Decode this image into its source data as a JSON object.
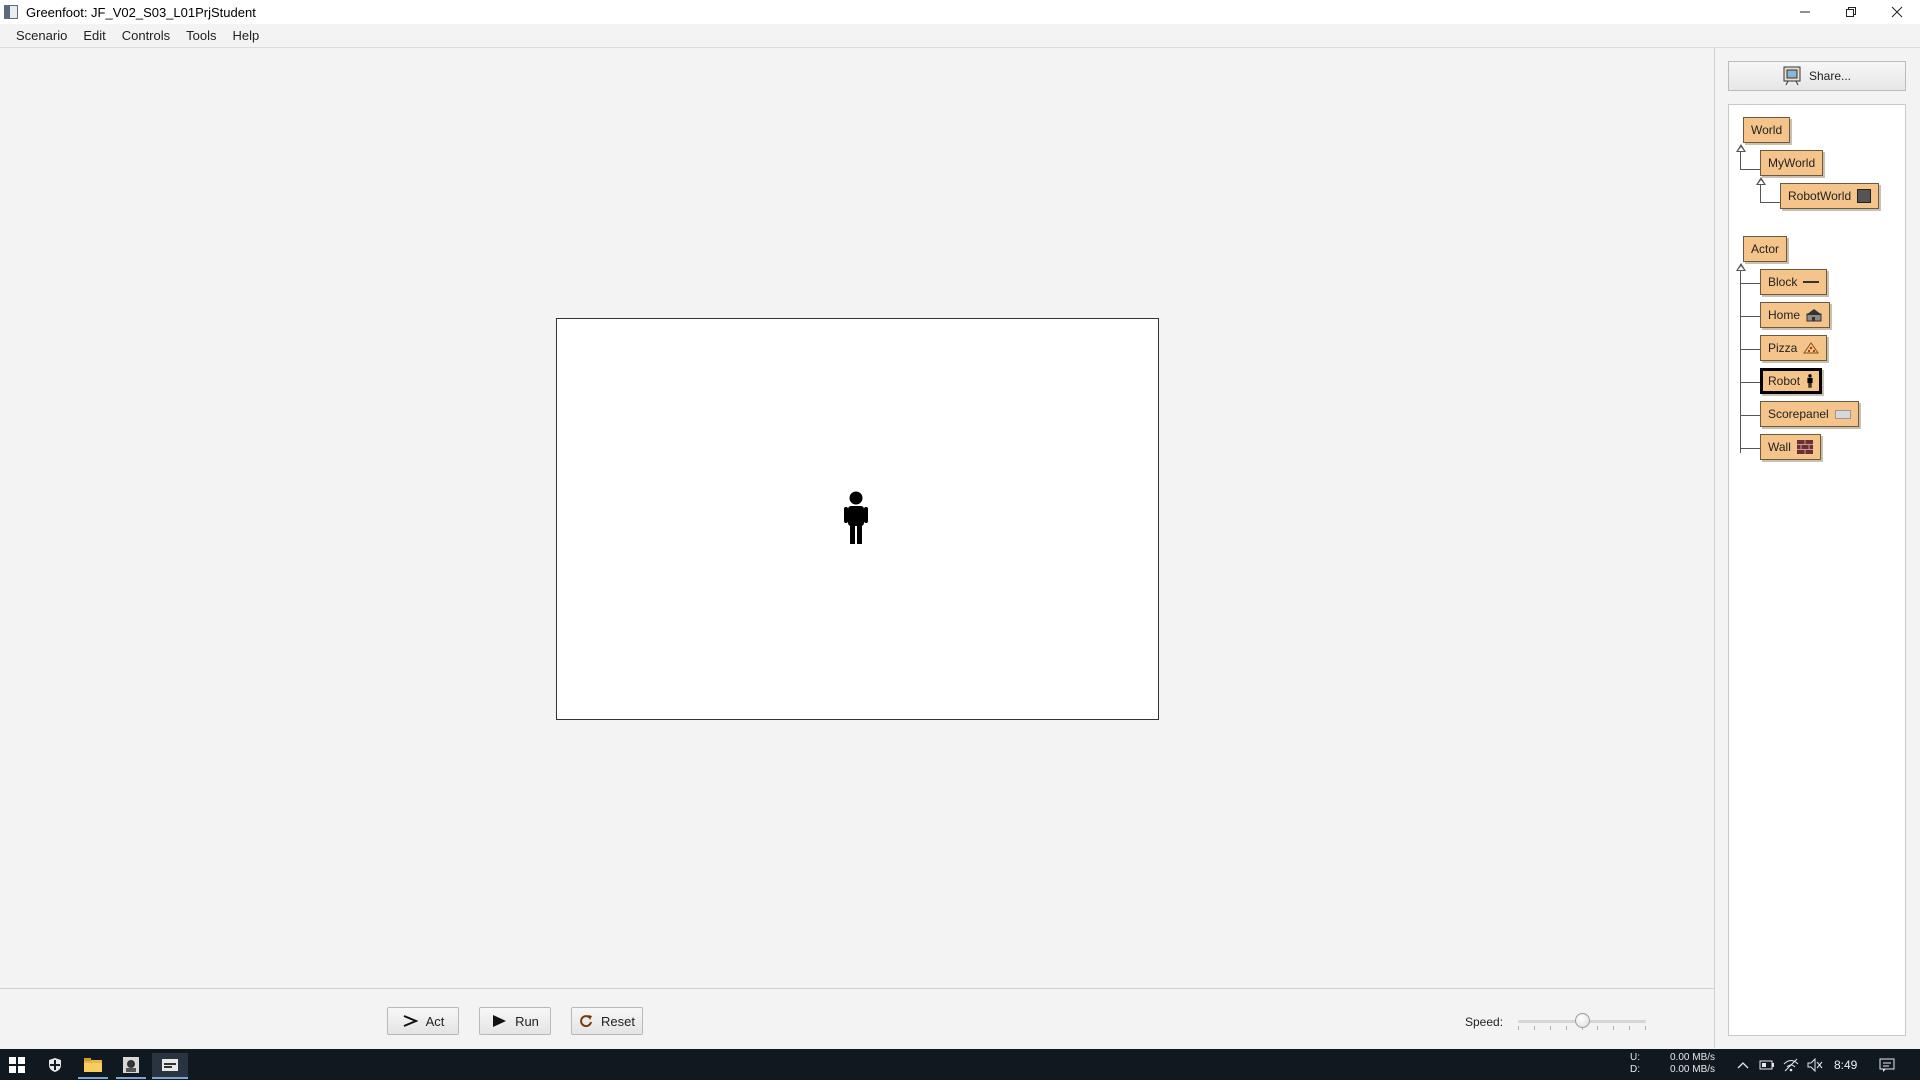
{
  "window": {
    "title": "Greenfoot: JF_V02_S03_L01PrjStudent"
  },
  "menu": {
    "items": [
      "Scenario",
      "Edit",
      "Controls",
      "Tools",
      "Help"
    ]
  },
  "controls": {
    "act_label": "Act",
    "run_label": "Run",
    "reset_label": "Reset",
    "speed_label": "Speed:",
    "speed_value": 0.5
  },
  "sidebar": {
    "share_label": "Share...",
    "world_classes": [
      "World",
      "MyWorld",
      "RobotWorld"
    ],
    "actor_classes": [
      "Actor",
      "Block",
      "Home",
      "Pizza",
      "Robot",
      "Scorepanel",
      "Wall"
    ],
    "selected_class": "Robot"
  },
  "taskbar": {
    "upload_label": "U:",
    "upload_value": "0.00 MB/s",
    "download_label": "D:",
    "download_value": "0.00 MB/s",
    "time": "8:49"
  },
  "icons": {
    "start": "windows-start-icon",
    "defender": "shield-icon",
    "explorer": "folder-icon",
    "greenfoot_task": "greenfoot-icon",
    "active_window": "window-icon"
  },
  "colors": {
    "class_fill": "#f5c48b",
    "taskbar": "#101820",
    "background": "#f3f3f3"
  }
}
